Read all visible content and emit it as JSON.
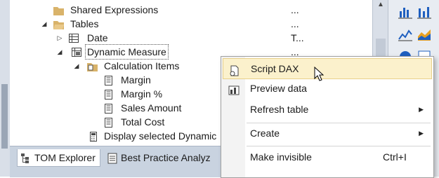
{
  "tree": {
    "rows": [
      {
        "label": "Shared Expressions",
        "col2": "...",
        "caret": "",
        "icon": "folder"
      },
      {
        "label": "Tables",
        "col2": "...",
        "caret": "◢",
        "icon": "folder"
      },
      {
        "label": "Date",
        "col2": "T...",
        "caret": "▷",
        "icon": "table"
      },
      {
        "label": "Dynamic Measure",
        "col2": "...",
        "caret": "◢",
        "icon": "calc-table"
      },
      {
        "label": "Calculation Items",
        "col2": "",
        "caret": "◢",
        "icon": "calc-items"
      },
      {
        "label": "Margin",
        "col2": "",
        "caret": "",
        "icon": "calc-item"
      },
      {
        "label": "Margin %",
        "col2": "",
        "caret": "",
        "icon": "calc-item"
      },
      {
        "label": "Sales Amount",
        "col2": "",
        "caret": "",
        "icon": "calc-item"
      },
      {
        "label": "Total Cost",
        "col2": "",
        "caret": "",
        "icon": "calc-item"
      },
      {
        "label": "Display selected Dynamic",
        "col2": "",
        "caret": "",
        "icon": "calculator"
      }
    ]
  },
  "tabs": [
    {
      "label": "TOM Explorer",
      "icon": "tom-explorer-icon"
    },
    {
      "label": "Best Practice Analyz",
      "icon": "best-practice-icon"
    }
  ],
  "context_menu": {
    "items": [
      {
        "label": "Script DAX",
        "shortcut": "",
        "submenu": false,
        "icon": "script-icon"
      },
      {
        "label": "Preview data",
        "shortcut": "",
        "submenu": false,
        "icon": "preview-data-icon"
      },
      {
        "label": "Refresh table",
        "shortcut": "",
        "submenu": true,
        "icon": ""
      },
      {
        "label": "Create",
        "shortcut": "",
        "submenu": true,
        "icon": ""
      },
      {
        "label": "Make invisible",
        "shortcut": "Ctrl+I",
        "submenu": false,
        "icon": ""
      }
    ]
  },
  "colors": {
    "hover_background": "#fbf1cc",
    "hover_border": "#e8d08a",
    "folder": "#d9b36a",
    "toolbar_icon": "#1f5fbf"
  }
}
